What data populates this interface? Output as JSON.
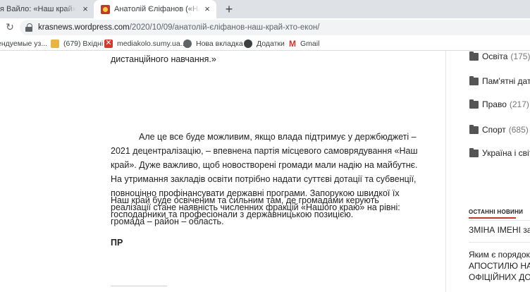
{
  "tabs": [
    {
      "title": "я Вайло: «Наш край» не да",
      "close": "×"
    },
    {
      "title": "Анатолій Єліфанов («НАШ КРАЇ",
      "close": "×"
    }
  ],
  "new_tab": "+",
  "address": {
    "domain": "krasnews.wordpress.com",
    "path": "/2020/10/09/анатолій-єліфанов-наш-край-хто-екон/"
  },
  "bookmarks": [
    {
      "label": "ендуемые уз...",
      "icon": "none"
    },
    {
      "label": "(679) Вхідні",
      "icon": "folder-icon"
    },
    {
      "label": "mediakolo.sumy.ua...",
      "icon": "ms-icon"
    },
    {
      "label": "Нова вкладка",
      "icon": "globe-icon"
    },
    {
      "label": "Додатки",
      "icon": "globe-icon"
    },
    {
      "label": "Gmail",
      "icon": "gmail-icon"
    }
  ],
  "article": {
    "p0": "дистанційного навчання.»",
    "p1": "Але це все буде можливим, якщо влада підтримує у держбюджеті – 2021 децентралізацію, – впевнена партія місцевого самоврядування «Наш край». Дуже важливо, щоб новостворені громади мали надію на майбутнє. На утримання закладів освіти потрібно надати суттєві дотації та субвенції, повноцінно профінансувати державні програми.  Запорукою швидкої їх реалізації стане наявність численних фракцій «Нашого краю» на рівні: громада – район – область.",
    "p2": "Наш край буде освіченим та сильним там, де громадами керують господарники та професіонали з державницькою позицією.",
    "p3": "ПР"
  },
  "sidebar": {
    "categories": [
      {
        "name": "Освіта",
        "count": "(175)"
      },
      {
        "name": "Пам'ятні дати",
        "count": ""
      },
      {
        "name": "Право",
        "count": "(217)"
      },
      {
        "name": "Спорт",
        "count": "(685)"
      },
      {
        "name": "Україна і світ",
        "count": ""
      }
    ],
    "news_title": "ОСТАННІ НОВИНИ",
    "news": [
      [
        "ЗМІНА ІМЕНІ за з"
      ],
      [
        "Яким є порядок п",
        "АПОСТИЛЮ НА",
        "ОФІЦІЙНИХ ДОК"
      ]
    ]
  },
  "colors": {
    "accent": "#c0392b",
    "tabstrip": "#dee1e6"
  }
}
